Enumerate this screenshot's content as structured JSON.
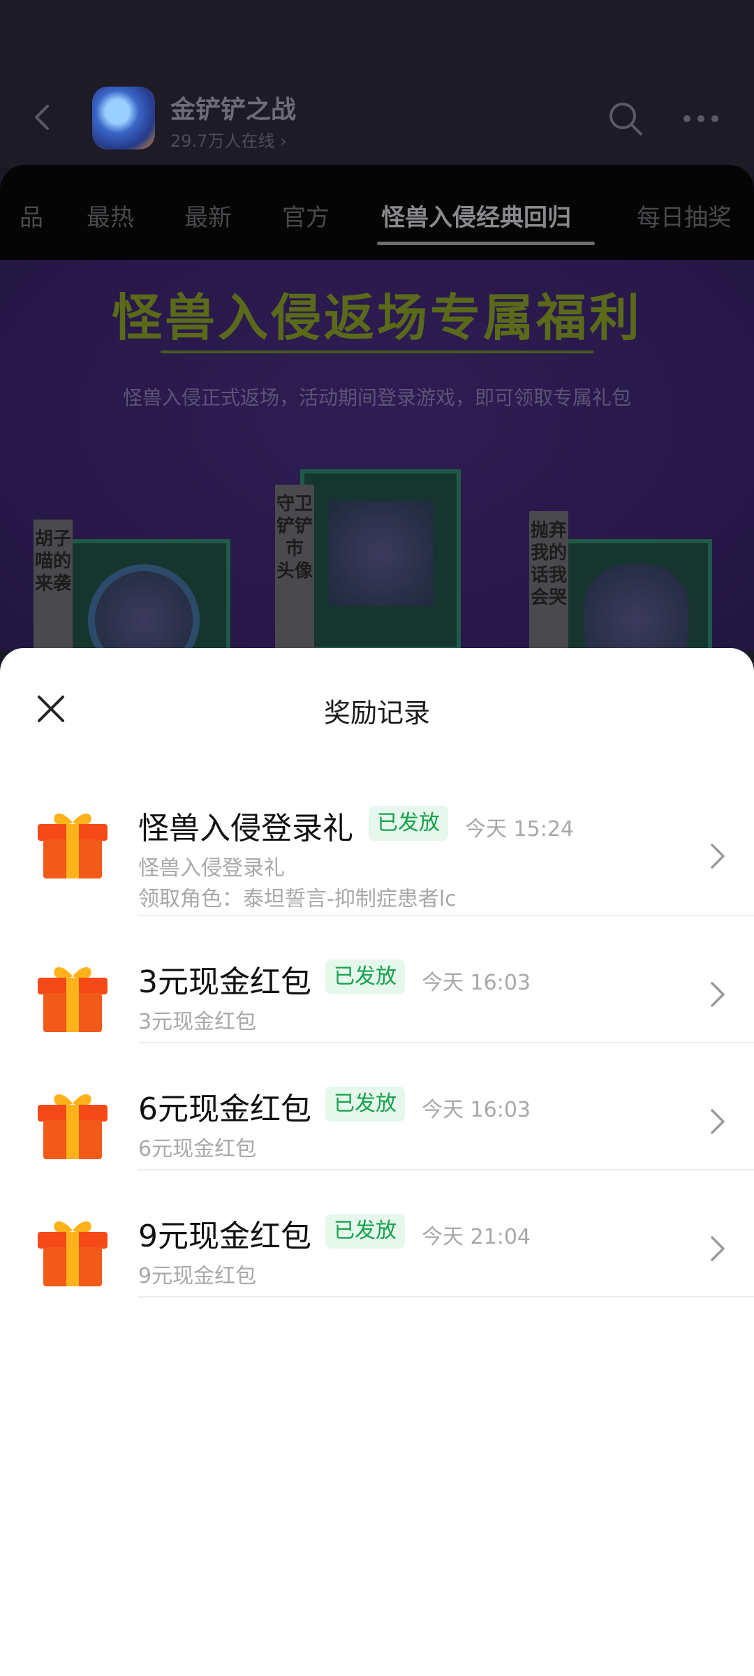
{
  "header": {
    "app_name": "金铲铲之战",
    "online": "29.7万人在线 ›"
  },
  "tabs": [
    {
      "label": "品"
    },
    {
      "label": "最热"
    },
    {
      "label": "最新"
    },
    {
      "label": "官方"
    },
    {
      "label": "怪兽入侵经典回归",
      "active": true
    },
    {
      "label": "每日抽奖"
    }
  ],
  "banner": {
    "title": "怪兽入侵返场专属福利",
    "subtitle": "怪兽入侵正式返场，活动期间登录游戏，即可领取专属礼包",
    "cards": [
      {
        "label": "胡子喵的来袭"
      },
      {
        "label": "守卫铲铲市 头像"
      },
      {
        "label": "抛弃我的话我会哭"
      }
    ]
  },
  "sheet": {
    "title": "奖励记录",
    "records": [
      {
        "title": "怪兽入侵登录礼",
        "status": "已发放",
        "time": "今天 15:24",
        "desc": "怪兽入侵登录礼",
        "role": "领取角色：泰坦誓言-抑制症患者lc"
      },
      {
        "title": "3元现金红包",
        "status": "已发放",
        "time": "今天 16:03",
        "desc": "3元现金红包"
      },
      {
        "title": "6元现金红包",
        "status": "已发放",
        "time": "今天 16:03",
        "desc": "6元现金红包"
      },
      {
        "title": "9元现金红包",
        "status": "已发放",
        "time": "今天 21:04",
        "desc": "9元现金红包"
      }
    ]
  },
  "colors": {
    "status_green": "#18a24f",
    "status_bg": "#e6f7ec",
    "gift_red": "#f25a1a",
    "gift_ribbon": "#ffb21c"
  },
  "icons": {
    "back": "chevron-left-icon",
    "search": "search-icon",
    "more": "more-dots-icon",
    "close": "close-icon",
    "gift": "gift-icon",
    "chevron": "chevron-right-icon"
  }
}
